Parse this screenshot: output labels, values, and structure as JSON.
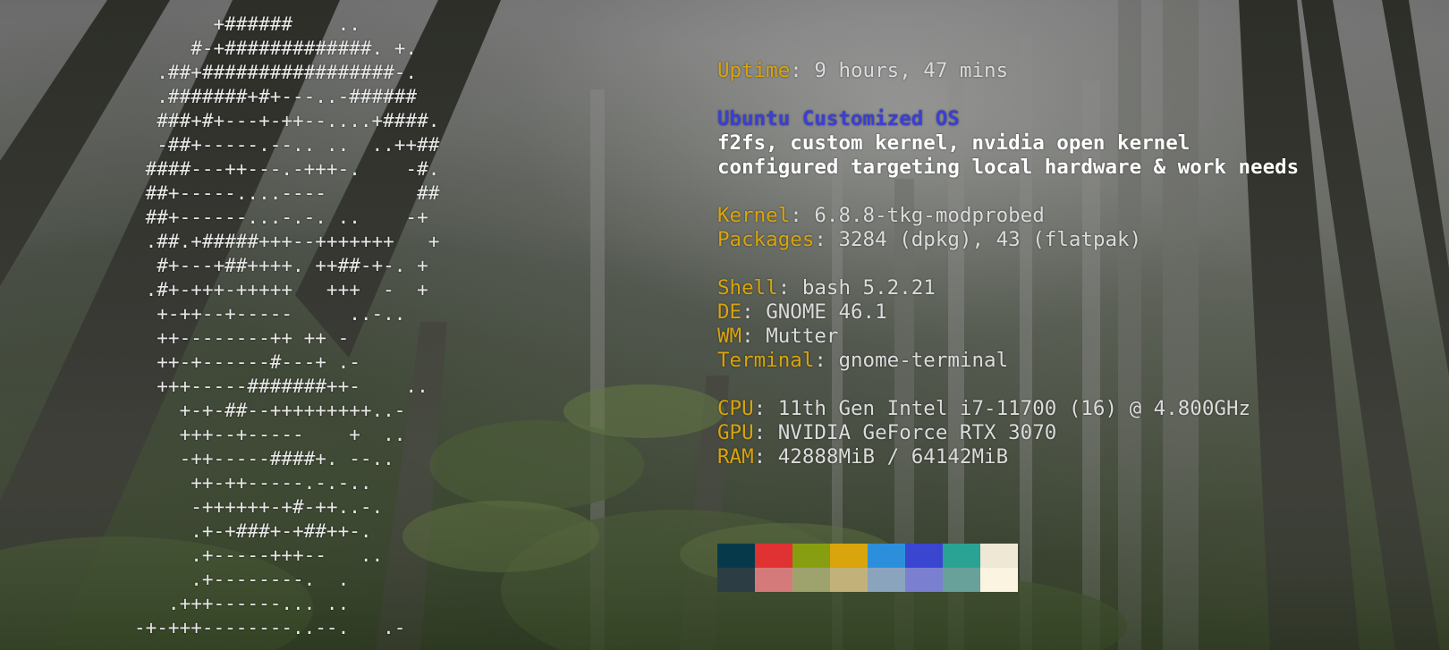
{
  "ascii_logo": [
    "       +######    ..",
    "     #-+#############. +.",
    "  .##+#################-.",
    "  .#######+#+---..-######",
    "  ###+#+---+-++--....+####.",
    "  -##+-----.--.. ..  ..++##",
    " ####---++---.-+++-.    -#.",
    " ##+-----....----        ##",
    " ##+------...-.-. ..    -+",
    " .##.+#####+++--+++++++   +",
    "  #+---+##++++. ++##-+-. +",
    " .#+-+++-+++++   +++  -  +",
    "  +-++--+-----     ..-..",
    "  ++--------++ ++ -",
    "  ++-+------#---+ .-",
    "  +++-----#######++-    ..",
    "    +-+-##--+++++++++..-",
    "    +++--+-----    +  ..",
    "    -++-----####+. --..",
    "     ++-++-----.-.-..",
    "     -++++++-+#-++..-.",
    "     .+-+###+-+##++-.",
    "     .+-----+++--   ..",
    "     .+--------.  .",
    "   .+++------... ..",
    "-+-+++--------..--.   .-"
  ],
  "info": {
    "uptime": {
      "key": "Uptime",
      "value": "9 hours, 47 mins"
    },
    "title": "Ubuntu Customized OS",
    "desc_line1": "f2fs, custom kernel, nvidia open kernel",
    "desc_line2": "configured targeting local hardware & work needs",
    "kernel": {
      "key": "Kernel",
      "value": "6.8.8-tkg-modprobed"
    },
    "packages": {
      "key": "Packages",
      "value": "3284 (dpkg), 43 (flatpak)"
    },
    "shell": {
      "key": "Shell",
      "value": "bash 5.2.21"
    },
    "de": {
      "key": "DE",
      "value": "GNOME 46.1"
    },
    "wm": {
      "key": "WM",
      "value": "Mutter"
    },
    "terminal": {
      "key": "Terminal",
      "value": "gnome-terminal"
    },
    "cpu": {
      "key": "CPU",
      "value": "11th Gen Intel i7-11700 (16) @ 4.800GHz"
    },
    "gpu": {
      "key": "GPU",
      "value": "NVIDIA GeForce RTX 3070"
    },
    "ram": {
      "key": "RAM",
      "value": "42888MiB / 64142MiB"
    },
    "separator": ": "
  },
  "colors": {
    "key": "#d9a40c",
    "title": "#3a3fd4",
    "palette_row1": [
      "#063a4a",
      "#e03232",
      "#879e10",
      "#d9a40c",
      "#2b8fdc",
      "#3a46d0",
      "#2aa394",
      "#eee8d4"
    ],
    "palette_row2": [
      "#2c3d44",
      "#d57a7a",
      "#9ea36e",
      "#c2b27a",
      "#8ba4bd",
      "#7a80cf",
      "#68a199",
      "#fbf4e0"
    ]
  }
}
